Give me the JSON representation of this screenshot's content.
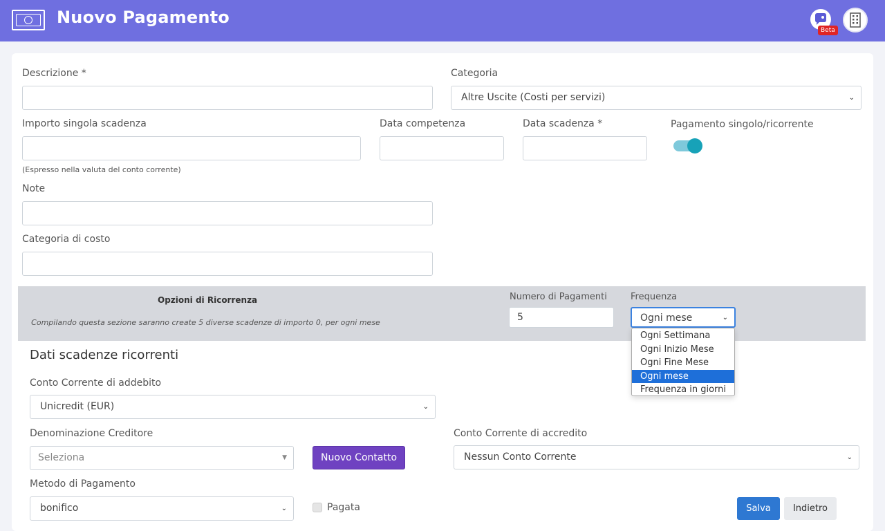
{
  "header": {
    "title": "Nuovo Pagamento",
    "beta_badge": "Beta",
    "accent_color": "#6f6fe0"
  },
  "form": {
    "descrizione": {
      "label": "Descrizione *",
      "value": ""
    },
    "categoria": {
      "label": "Categoria",
      "value": "Altre Uscite (Costi per servizi)"
    },
    "importo": {
      "label": "Importo singola scadenza",
      "value": "",
      "hint": "(Espresso nella valuta del conto corrente)"
    },
    "data_competenza": {
      "label": "Data competenza",
      "value": ""
    },
    "data_scadenza": {
      "label": "Data scadenza *",
      "value": ""
    },
    "pagamento_tipo": {
      "label": "Pagamento singolo/ricorrente",
      "on": true
    },
    "note": {
      "label": "Note",
      "value": ""
    },
    "categoria_costo": {
      "label": "Categoria di costo",
      "value": ""
    }
  },
  "ricorrenza": {
    "title": "Opzioni di Ricorrenza",
    "note": "Compilando questa sezione saranno create 5 diverse scadenze di importo 0, per ogni mese",
    "numero_pagamenti": {
      "label": "Numero di Pagamenti",
      "value": "5"
    },
    "frequenza": {
      "label": "Frequenza",
      "value": "Ogni mese",
      "options": [
        "Ogni Settimana",
        "Ogni Inizio Mese",
        "Ogni Fine Mese",
        "Ogni mese",
        "Frequenza in giorni"
      ],
      "selected_index": 3
    }
  },
  "ricorrenti": {
    "title": "Dati scadenze ricorrenti",
    "conto_addebito": {
      "label": "Conto Corrente di addebito",
      "value": "Unicredit (EUR)"
    },
    "creditore": {
      "label": "Denominazione Creditore",
      "placeholder": "Seleziona"
    },
    "nuovo_contatto": "Nuovo Contatto",
    "conto_accredito": {
      "label": "Conto Corrente di accredito",
      "value": "Nessun Conto Corrente"
    },
    "metodo": {
      "label": "Metodo di Pagamento",
      "value": "bonifico"
    },
    "pagata": {
      "label": "Pagata",
      "checked": false
    }
  },
  "actions": {
    "save": "Salva",
    "back": "Indietro"
  }
}
